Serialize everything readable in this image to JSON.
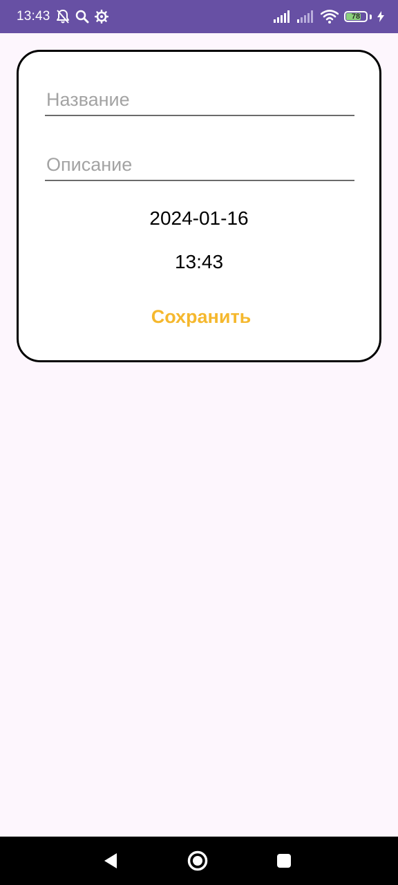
{
  "status_bar": {
    "time": "13:43",
    "battery_level": "78",
    "battery_fraction": 0.78,
    "background_color": "#6750a4",
    "icons": [
      "notifications-off-icon",
      "search-icon",
      "settings-gear-icon",
      "signal-icon",
      "signal-weak-icon",
      "wifi-icon",
      "battery-icon",
      "charging-bolt-icon"
    ]
  },
  "form": {
    "title_placeholder": "Название",
    "title_value": "",
    "description_placeholder": "Описание",
    "description_value": "",
    "date": "2024-01-16",
    "time": "13:43",
    "save_label": "Сохранить",
    "save_color": "#f5b82e"
  },
  "nav_bar": {
    "icons": [
      "back-icon",
      "home-icon",
      "recents-icon"
    ]
  }
}
